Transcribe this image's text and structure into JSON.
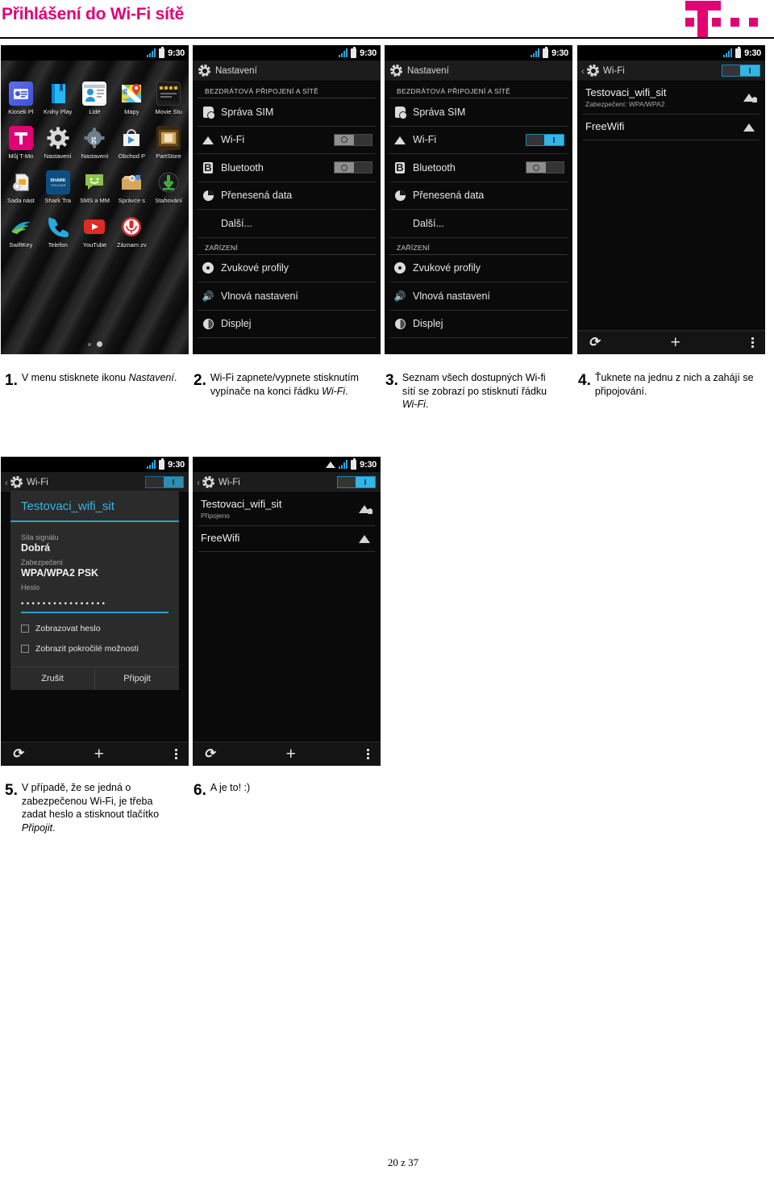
{
  "header": {
    "title": "Přihlášení do Wi-Fi sítě",
    "logo_name": "T-Mobile",
    "brand_color": "#e20074"
  },
  "statusbar": {
    "time": "9:30"
  },
  "phones": {
    "home": {
      "name": "Android app drawer",
      "apps": [
        {
          "label": "Kiosek Pl",
          "icon": "newsstand-icon"
        },
        {
          "label": "Knihy Play",
          "icon": "play-books-icon"
        },
        {
          "label": "Lidé",
          "icon": "people-icon"
        },
        {
          "label": "Mapy",
          "icon": "maps-icon"
        },
        {
          "label": "Movie Stu",
          "icon": "movie-studio-icon"
        },
        {
          "label": "Můj T-Mo",
          "icon": "tmobile-icon"
        },
        {
          "label": "Nastavení",
          "icon": "settings-gear-icon"
        },
        {
          "label": "Nastavení",
          "icon": "google-settings-icon"
        },
        {
          "label": "Obchod P",
          "icon": "play-store-icon"
        },
        {
          "label": "PartStore",
          "icon": "partstore-icon"
        },
        {
          "label": "Sada nást",
          "icon": "sim-toolkit-icon"
        },
        {
          "label": "Shark Tra",
          "icon": "shark-tracker-icon"
        },
        {
          "label": "SMS a MM",
          "icon": "messaging-icon"
        },
        {
          "label": "Správce s",
          "icon": "file-manager-icon"
        },
        {
          "label": "Stahování",
          "icon": "downloads-icon"
        },
        {
          "label": "SwiftKey",
          "icon": "swiftkey-icon"
        },
        {
          "label": "Telefon",
          "icon": "phone-icon"
        },
        {
          "label": "YouTube",
          "icon": "youtube-icon"
        },
        {
          "label": "Záznam zv",
          "icon": "sound-recorder-icon"
        }
      ]
    },
    "settings_off": {
      "title": "Nastavení",
      "section_wireless": "BEZDRÁTOVÁ PŘIPOJENÍ A SÍTĚ",
      "section_device": "ZAŘÍZENÍ",
      "rows": {
        "sim": "Správa SIM",
        "wifi": "Wi-Fi",
        "bluetooth": "Bluetooth",
        "data": "Přenesená data",
        "more": "Další...",
        "sound": "Zvukové profily",
        "wave": "Vlnová nastavení",
        "display": "Displej"
      },
      "wifi_state": "off",
      "bluetooth_state": "off"
    },
    "settings_on": {
      "title": "Nastavení",
      "section_wireless": "BEZDRÁTOVÁ PŘIPOJENÍ A SÍTĚ",
      "section_device": "ZAŘÍZENÍ",
      "rows": {
        "sim": "Správa SIM",
        "wifi": "Wi-Fi",
        "bluetooth": "Bluetooth",
        "data": "Přenesená data",
        "more": "Další...",
        "sound": "Zvukové profily",
        "wave": "Vlnová nastavení",
        "display": "Displej"
      },
      "wifi_state": "on",
      "bluetooth_state": "off"
    },
    "wifi_list": {
      "title": "Wi-Fi",
      "toggle_state": "on",
      "networks": [
        {
          "ssid": "Testovaci_wifi_sit",
          "sub": "Zabezpečení: WPA/WPA2",
          "secured": true
        },
        {
          "ssid": "FreeWifi",
          "sub": "",
          "secured": false
        }
      ]
    },
    "wifi_password": {
      "title": "Wi-Fi",
      "toggle_state": "on",
      "dialog": {
        "ssid": "Testovaci_wifi_sit",
        "signal_label": "Síla signálu",
        "signal_value": "Dobrá",
        "security_label": "Zabezpečení",
        "security_value": "WPA/WPA2 PSK",
        "password_label": "Heslo",
        "password_value": "••••••••••••••••",
        "show_password": "Zobrazovat heslo",
        "advanced": "Zobrazit pokročilé možnosti",
        "cancel": "Zrušit",
        "connect": "Připojit"
      }
    },
    "wifi_connected": {
      "title": "Wi-Fi",
      "toggle_state": "on",
      "networks": [
        {
          "ssid": "Testovaci_wifi_sit",
          "sub": "Připojeno",
          "secured": true
        },
        {
          "ssid": "FreeWifi",
          "sub": "",
          "secured": false
        }
      ]
    }
  },
  "steps": [
    {
      "num": "1.",
      "text_before": "V menu stisknete ikonu ",
      "italic": "Nastavení",
      "text_after": "."
    },
    {
      "num": "2.",
      "text_before": "Wi-Fi zapnete/vypnete stisknutím vypínače na konci řádku ",
      "italic": "Wi-Fi",
      "text_after": "."
    },
    {
      "num": "3.",
      "text_before": "Seznam všech dostupných Wi-fi sítí se zobrazí po stisknutí řádku ",
      "italic": "Wi-Fi",
      "text_after": "."
    },
    {
      "num": "4.",
      "text_before": "Ťuknete na jednu z nich a zahájí se připojování.",
      "italic": "",
      "text_after": ""
    },
    {
      "num": "5.",
      "text_before": "V případě, že se jedná o zabezpečenou Wi-Fi, je třeba zadat heslo a stisknout tlačítko ",
      "italic": "Připojit",
      "text_after": "."
    },
    {
      "num": "6.",
      "text_before": "A je to! :)",
      "italic": "",
      "text_after": ""
    }
  ],
  "footer": {
    "page": "20 z 37"
  }
}
